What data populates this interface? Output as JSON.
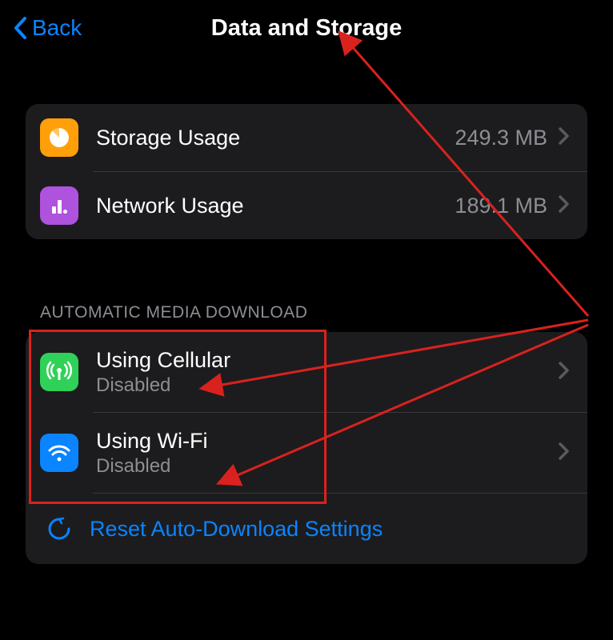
{
  "header": {
    "back_label": "Back",
    "title": "Data and Storage"
  },
  "usage_group": {
    "storage": {
      "label": "Storage Usage",
      "value": "249.3 MB"
    },
    "network": {
      "label": "Network Usage",
      "value": "189.1 MB"
    }
  },
  "auto_download": {
    "header": "AUTOMATIC MEDIA DOWNLOAD",
    "cellular": {
      "label": "Using Cellular",
      "status": "Disabled"
    },
    "wifi": {
      "label": "Using Wi-Fi",
      "status": "Disabled"
    },
    "reset_label": "Reset Auto-Download Settings"
  },
  "colors": {
    "accent": "#0a84ff",
    "annotation": "#d9221e"
  }
}
